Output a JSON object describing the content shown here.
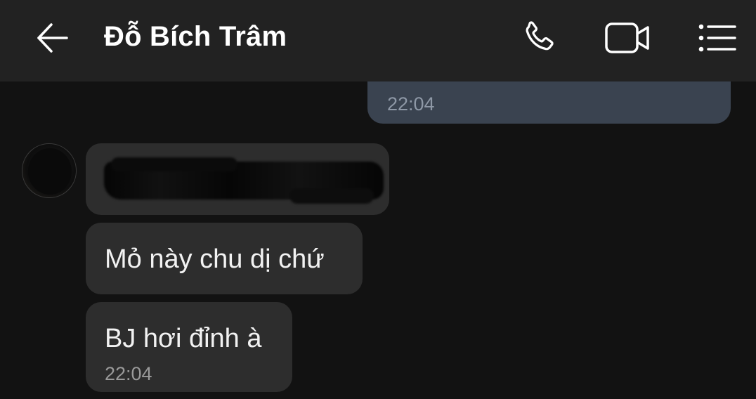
{
  "header": {
    "contact_name": "Đỗ Bích Trâm",
    "back_icon": "arrow-left-icon",
    "call_icon": "phone-icon",
    "video_icon": "video-camera-icon",
    "menu_icon": "list-menu-icon"
  },
  "messages": [
    {
      "direction": "outgoing",
      "text": "",
      "time": "22:04",
      "partially_visible": true
    },
    {
      "direction": "incoming",
      "text": "",
      "redacted": true
    },
    {
      "direction": "incoming",
      "text": "Mỏ này chu dị chứ"
    },
    {
      "direction": "incoming",
      "text": "BJ hơi đỉnh à",
      "time": "22:04"
    }
  ],
  "colors": {
    "background": "#121212",
    "header": "#222222",
    "incoming_bubble": "#2d2d2d",
    "outgoing_bubble": "#3a4350",
    "text": "#f2f2f2",
    "time": "#9a9a9a"
  }
}
